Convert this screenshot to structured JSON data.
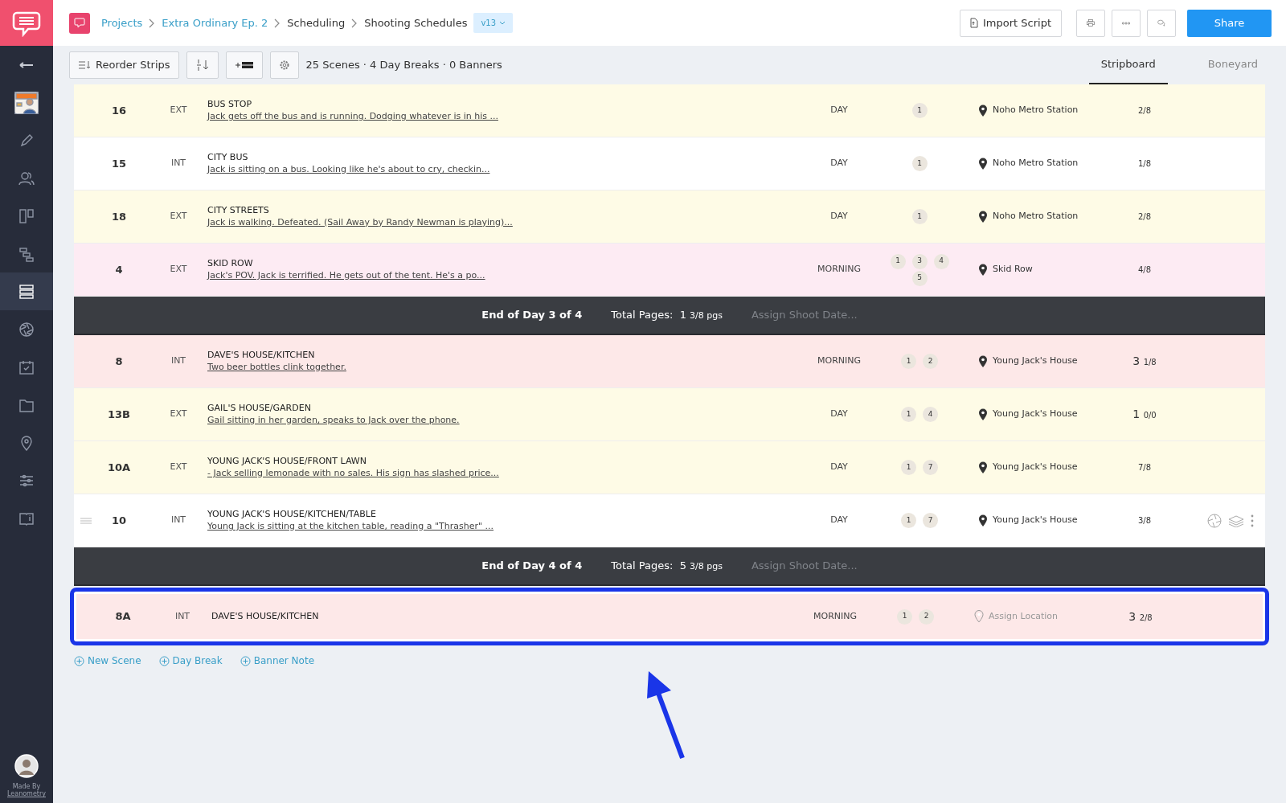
{
  "breadcrumb": [
    {
      "label": "Projects",
      "link": true
    },
    {
      "label": "Extra Ordinary Ep. 2",
      "link": true
    },
    {
      "label": "Scheduling",
      "link": false
    },
    {
      "label": "Shooting Schedules",
      "link": false
    }
  ],
  "version": "v13",
  "header_buttons": [
    {
      "kind": "import",
      "label": "Import Script"
    },
    {
      "kind": "print"
    },
    {
      "kind": "more"
    },
    {
      "kind": "comments"
    },
    {
      "kind": "share",
      "label": "Share"
    }
  ],
  "toolbar": {
    "reorder_label": "Reorder Strips",
    "summary": "25 Scenes · 4 Day Breaks · 0 Banners"
  },
  "tabs": [
    {
      "label": "Stripboard",
      "selected": true
    },
    {
      "label": "Boneyard",
      "selected": false
    }
  ],
  "sidebar": {
    "items": [
      {
        "kind": "back",
        "selected": false
      },
      {
        "kind": "project",
        "selected": false
      },
      {
        "kind": "pencil",
        "selected": false
      },
      {
        "kind": "people",
        "selected": false
      },
      {
        "kind": "board",
        "selected": false
      },
      {
        "kind": "gantt",
        "selected": false
      },
      {
        "kind": "list",
        "selected": true
      },
      {
        "kind": "aperture",
        "selected": false
      },
      {
        "kind": "calendar",
        "selected": false
      },
      {
        "kind": "folder",
        "selected": false
      },
      {
        "kind": "pin",
        "selected": false
      },
      {
        "kind": "sliders",
        "selected": false
      },
      {
        "kind": "book",
        "selected": false
      }
    ],
    "credit_line1": "Made By",
    "credit_line2": "Leanometry"
  },
  "strips": [
    {
      "kind": "scene",
      "number": "16",
      "ie": "EXT",
      "title": "BUS STOP",
      "synopsis": "Jack gets off the bus and is running. Dodging whatever is in his ...",
      "time": "DAY",
      "cast": [
        "1"
      ],
      "location": "Noho Metro Station",
      "location_assigned": true,
      "pages_fraction": "2/8",
      "color": "#fefbe6",
      "hovered": false,
      "highlighted": false
    },
    {
      "kind": "scene",
      "number": "15",
      "ie": "INT",
      "title": "CITY BUS",
      "synopsis": "Jack is sitting on a bus. Looking like he's about to cry, checkin...",
      "time": "DAY",
      "cast": [
        "1"
      ],
      "location": "Noho Metro Station",
      "location_assigned": true,
      "pages_fraction": "1/8",
      "color": "#ffffff",
      "hovered": false,
      "highlighted": false
    },
    {
      "kind": "scene",
      "number": "18",
      "ie": "EXT",
      "title": "CITY STREETS",
      "synopsis": "Jack is walking. Defeated. (Sail Away by Randy Newman is playing)...",
      "time": "DAY",
      "cast": [
        "1"
      ],
      "location": "Noho Metro Station",
      "location_assigned": true,
      "pages_fraction": "2/8",
      "color": "#fefbe6",
      "hovered": false,
      "highlighted": false
    },
    {
      "kind": "scene",
      "number": "4",
      "ie": "EXT",
      "title": "SKID ROW",
      "synopsis": "Jack's POV. Jack is terrified. He gets out of the tent. He's a po...",
      "time": "MORNING",
      "cast": [
        "1",
        "3",
        "4",
        "5"
      ],
      "location": "Skid Row",
      "location_assigned": true,
      "pages_fraction": "4/8",
      "color": "#fdebf3",
      "hovered": false,
      "highlighted": false
    },
    {
      "kind": "daybreak",
      "label": "End of Day 3 of 4",
      "pages_label": "Total Pages:",
      "pages_whole": "1",
      "pages_fraction": "3/8 pgs",
      "date_placeholder": "Assign Shoot Date..."
    },
    {
      "kind": "scene",
      "number": "8",
      "ie": "INT",
      "title": "DAVE'S HOUSE/KITCHEN",
      "synopsis": "Two beer bottles clink together.",
      "time": "MORNING",
      "cast": [
        "1",
        "2"
      ],
      "location": "Young Jack's House",
      "location_assigned": true,
      "pages_whole": "3",
      "pages_fraction": "1/8",
      "color": "#fde8e8",
      "hovered": false,
      "highlighted": false
    },
    {
      "kind": "scene",
      "number": "13B",
      "ie": "EXT",
      "title": "GAIL'S HOUSE/GARDEN",
      "synopsis": "Gail sitting in her garden, speaks to Jack over the phone.",
      "time": "DAY",
      "cast": [
        "1",
        "4"
      ],
      "location": "Young Jack's House",
      "location_assigned": true,
      "pages_whole": "1",
      "pages_fraction": "0/0",
      "color": "#fefbe6",
      "hovered": false,
      "highlighted": false
    },
    {
      "kind": "scene",
      "number": "10A",
      "ie": "EXT",
      "title": "YOUNG JACK'S HOUSE/FRONT LAWN",
      "synopsis": "- Jack selling lemonade with no sales. His sign has slashed price...",
      "time": "DAY",
      "cast": [
        "1",
        "7"
      ],
      "location": "Young Jack's House",
      "location_assigned": true,
      "pages_fraction": "7/8",
      "color": "#fefbe6",
      "hovered": false,
      "highlighted": false
    },
    {
      "kind": "scene",
      "number": "10",
      "ie": "INT",
      "title": "YOUNG JACK'S HOUSE/KITCHEN/TABLE",
      "synopsis": "Young Jack is sitting at the kitchen table, reading a \"Thrasher\" ...",
      "time": "DAY",
      "cast": [
        "1",
        "7"
      ],
      "location": "Young Jack's House",
      "location_assigned": true,
      "pages_fraction": "3/8",
      "color": "#ffffff",
      "hovered": true,
      "highlighted": false
    },
    {
      "kind": "daybreak",
      "label": "End of Day 4 of 4",
      "pages_label": "Total Pages:",
      "pages_whole": "5",
      "pages_fraction": "3/8 pgs",
      "date_placeholder": "Assign Shoot Date..."
    },
    {
      "kind": "scene",
      "number": "8A",
      "ie": "INT",
      "title": "DAVE'S HOUSE/KITCHEN",
      "time": "MORNING",
      "cast": [
        "1",
        "2"
      ],
      "location": "Assign Location",
      "location_assigned": false,
      "pages_whole": "3",
      "pages_fraction": "2/8",
      "color": "#fde8e8",
      "hovered": false,
      "highlighted": true
    }
  ],
  "add_links": [
    {
      "label": "New Scene"
    },
    {
      "label": "Day Break"
    },
    {
      "label": "Banner Note"
    }
  ],
  "annotation_arrow": true
}
